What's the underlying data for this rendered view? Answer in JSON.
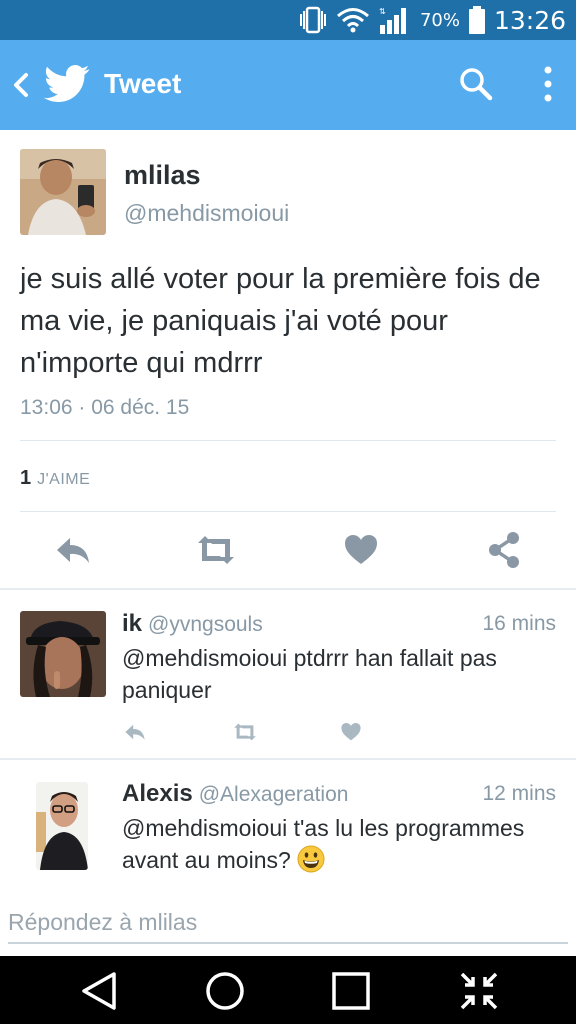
{
  "status_bar": {
    "battery_percent": "70%",
    "time": "13:26"
  },
  "app_bar": {
    "title": "Tweet",
    "icons": [
      "back-arrow-icon",
      "twitter-bird-icon",
      "search-icon",
      "more-vert-icon"
    ]
  },
  "main_tweet": {
    "name": "mlilas",
    "handle": "@mehdismoioui",
    "text": "je suis allé voter pour la première fois de ma vie, je paniquais j'ai voté pour n'importe qui mdrrr",
    "timestamp": "13:06 · 06 déc. 15",
    "likes_count": "1",
    "likes_label": "J'AIME",
    "actions": [
      "reply-icon",
      "retweet-icon",
      "like-icon",
      "share-icon"
    ]
  },
  "replies": [
    {
      "name": "ik",
      "handle": "@yvngsouls",
      "time": "16 mins",
      "text": "@mehdismoioui ptdrrr han fallait pas paniquer"
    },
    {
      "name": "Alexis",
      "handle": "@Alexageration",
      "time": "12 mins",
      "text": "@mehdismoioui t'as lu les programmes avant au moins?"
    }
  ],
  "reply_input": {
    "placeholder": "Répondez à mlilas"
  },
  "colors": {
    "accent": "#55acee",
    "status_bar": "#1f6fa8",
    "secondary_text": "#8899a6",
    "icon_grey": "#aab8c2"
  }
}
